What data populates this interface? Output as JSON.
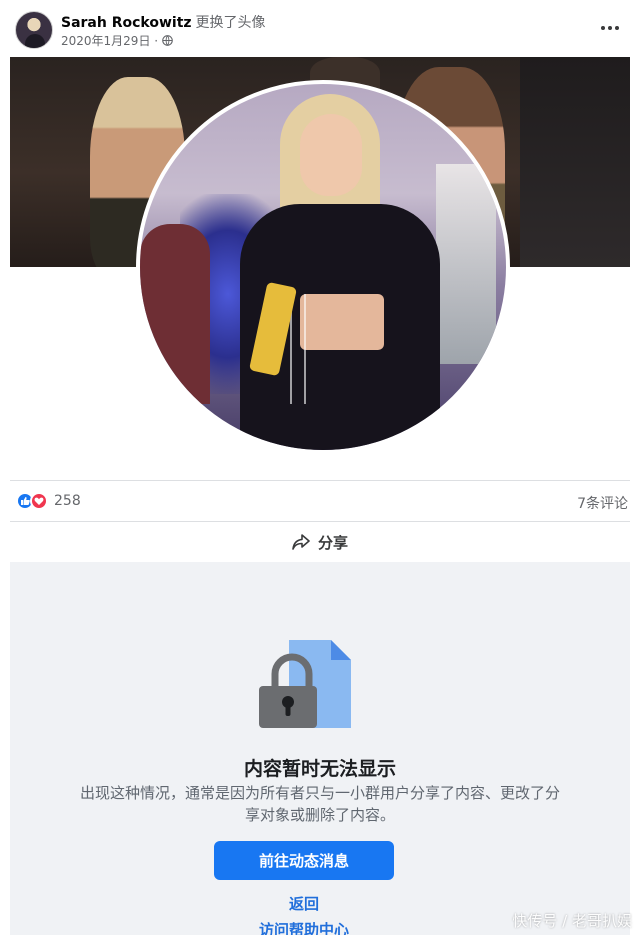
{
  "post": {
    "author": "Sarah Rockowitz",
    "action": "更换了头像",
    "date": "2020年1月29日 ·",
    "privacy_icon": "globe-icon",
    "more_icon": "more-horizontal-icon"
  },
  "engagement": {
    "reactions": [
      "like-icon",
      "love-icon"
    ],
    "reaction_count": "258",
    "comments": "7条评论"
  },
  "share": {
    "icon": "share-arrow-icon",
    "label": "分享"
  },
  "unavailable": {
    "icon": "lock-document-icon",
    "title": "内容暂时无法显示",
    "description": "出现这种情况，通常是因为所有者只与一小群用户分享了内容、更改了分享对象或删除了内容。",
    "primary_button": "前往动态消息",
    "back_link": "返回",
    "help_link": "访问帮助中心"
  },
  "watermark": "快传号 / 老哥扒娱",
  "colors": {
    "accent": "#1877f2",
    "love": "#f0364f",
    "panel_bg": "#f0f2f5"
  }
}
